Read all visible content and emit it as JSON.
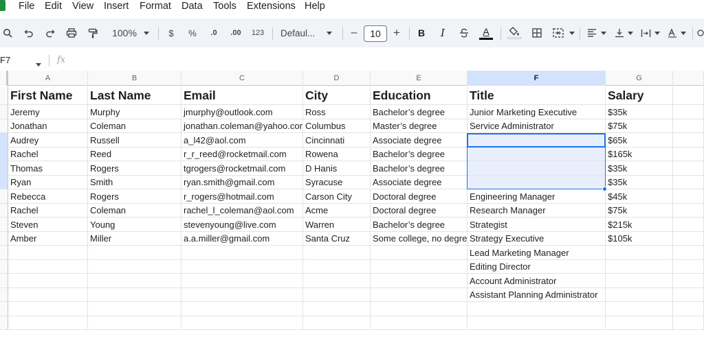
{
  "menu": [
    "File",
    "Edit",
    "View",
    "Insert",
    "Format",
    "Data",
    "Tools",
    "Extensions",
    "Help"
  ],
  "toolbar": {
    "zoom": "100%",
    "currency": "$",
    "percent": "%",
    "decrease_decimal": ".0",
    "increase_decimal": ".00",
    "number_format": "123",
    "font_family": "Defaul...",
    "font_size": "10",
    "minus": "–",
    "plus": "+",
    "bold": "B",
    "italic": "I",
    "text_color": "A"
  },
  "formula_bar": {
    "name_box": "F7",
    "fx": "fx"
  },
  "columns": [
    "A",
    "B",
    "C",
    "D",
    "E",
    "F",
    "G"
  ],
  "selected_column": "F",
  "header_row": [
    "First Name",
    "Last Name",
    "Email",
    "City",
    "Education",
    "Title",
    "Salary"
  ],
  "rows": [
    [
      "Jeremy",
      "Murphy",
      "jmurphy@outlook.com",
      "Ross",
      "Bachelor’s degree",
      "Junior Marketing Executive",
      "$35k"
    ],
    [
      "Jonathan",
      "Coleman",
      "jonathan.coleman@yahoo.cor",
      "Columbus",
      "Master’s degree",
      "Service Administrator",
      "$75k"
    ],
    [
      "Audrey",
      "Russell",
      "a_l42@aol.com",
      "Cincinnati",
      "Associate degree",
      "",
      "$65k"
    ],
    [
      "Rachel",
      "Reed",
      "r_r_reed@rocketmail.com",
      "Rowena",
      "Bachelor’s degree",
      "",
      "$165k"
    ],
    [
      "Thomas",
      "Rogers",
      "tgrogers@rocketmail.com",
      "D Hanis",
      "Bachelor’s degree",
      "",
      "$35k"
    ],
    [
      "Ryan",
      "Smith",
      "ryan.smith@gmail.com",
      "Syracuse",
      "Associate degree",
      "",
      "$35k"
    ],
    [
      "Rebecca",
      "Rogers",
      "r_rogers@hotmail.com",
      "Carson City",
      "Doctoral degree",
      "Engineering Manager",
      "$45k"
    ],
    [
      "Rachel",
      "Coleman",
      "rachel_l_coleman@aol.com",
      "Acme",
      "Doctoral degree",
      "Research Manager",
      "$75k"
    ],
    [
      "Steven",
      "Young",
      "stevenyoung@live.com",
      "Warren",
      "Bachelor’s degree",
      "Strategist",
      "$215k"
    ],
    [
      "Amber",
      "Miller",
      "a.a.miller@gmail.com",
      "Santa Cruz",
      "Some college, no degre",
      "Strategy Executive",
      "$105k"
    ],
    [
      "",
      "",
      "",
      "",
      "",
      "Lead Marketing Manager",
      ""
    ],
    [
      "",
      "",
      "",
      "",
      "",
      "Editing Director",
      ""
    ],
    [
      "",
      "",
      "",
      "",
      "",
      "Account Administrator",
      ""
    ],
    [
      "",
      "",
      "",
      "",
      "",
      "Assistant Planning Administrator",
      ""
    ],
    [
      "",
      "",
      "",
      "",
      "",
      "",
      ""
    ],
    [
      "",
      "",
      "",
      "",
      "",
      "",
      ""
    ]
  ],
  "colors": {
    "selection": "#1a73e8",
    "selected_header": "#d3e3fd",
    "toolbar_bg": "#f0f4f9"
  }
}
